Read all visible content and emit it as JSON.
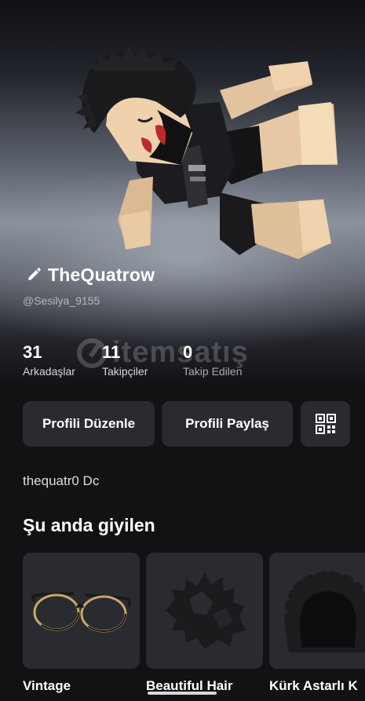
{
  "profile": {
    "display_name": "TheQuatrow",
    "username": "@Sesilya_9155",
    "bio": "thequatr0 Dc"
  },
  "stats": [
    {
      "value": "31",
      "label": "Arkadaşlar"
    },
    {
      "value": "11",
      "label": "Takipçiler"
    },
    {
      "value": "0",
      "label": "Takip Edilen"
    }
  ],
  "actions": {
    "edit_label": "Profili Düzenle",
    "share_label": "Profili Paylaş",
    "qr_icon": "qr-code-icon"
  },
  "section": {
    "title": "Şu anda giyilen"
  },
  "wearing": [
    {
      "name": "Vintage",
      "icon": "glasses-icon"
    },
    {
      "name": "Beautiful Hair",
      "icon": "spiky-hair-icon"
    },
    {
      "name": "Kürk Astarlı K",
      "icon": "fur-hood-icon"
    }
  ],
  "watermark": {
    "text": "itemsatış"
  },
  "colors": {
    "background": "#121215",
    "button": "#2a2b30",
    "text_primary": "#ffffff",
    "text_secondary": "#b4b7bd"
  }
}
